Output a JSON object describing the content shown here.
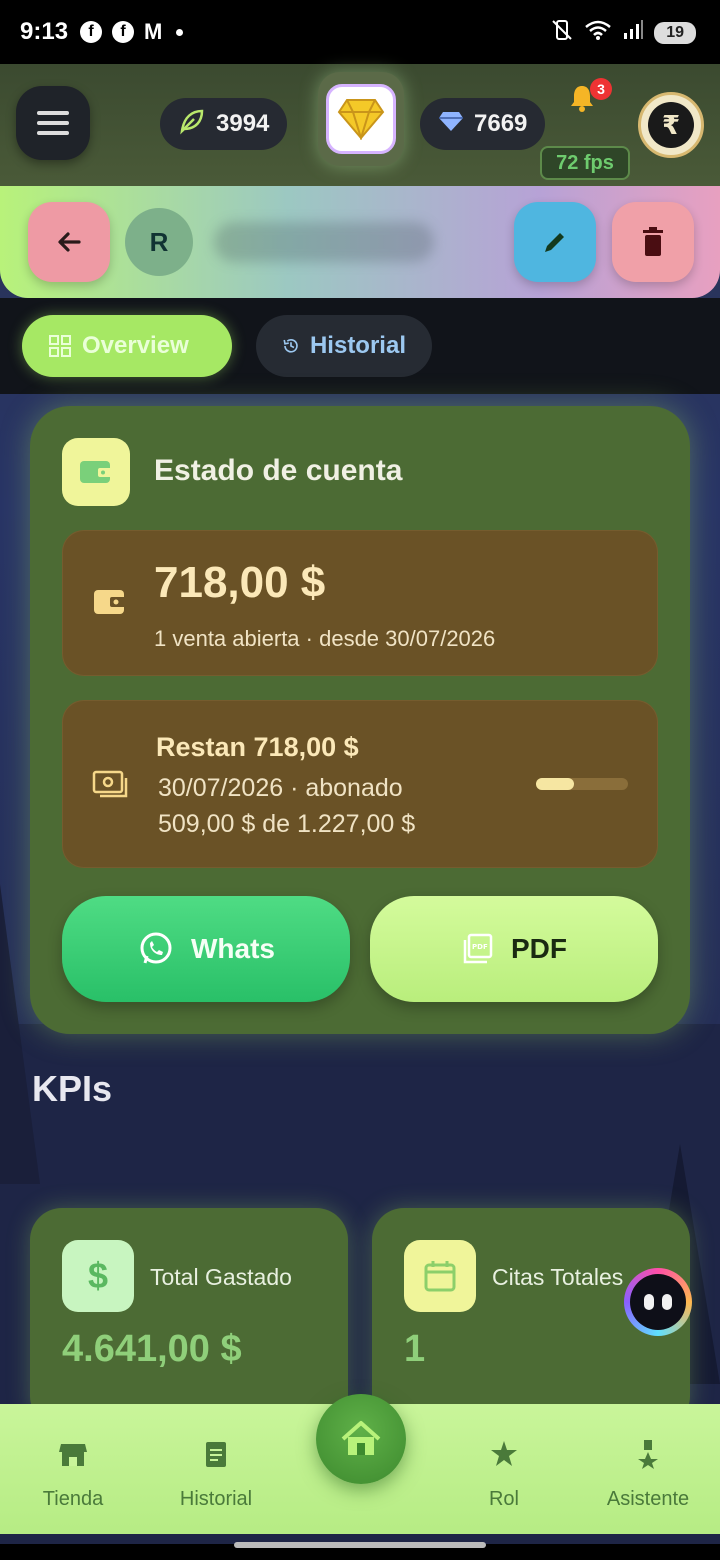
{
  "status_bar": {
    "time": "9:13",
    "left_icons": [
      "facebook-icon",
      "facebook-icon",
      "gmail-icon",
      "dot-icon"
    ],
    "right_icons": [
      "vibrate-mute-icon",
      "wifi-icon",
      "signal-icon"
    ],
    "battery": "19"
  },
  "header": {
    "leaves": "3994",
    "gems": "7669",
    "notifications_count": "3",
    "fps": "72 fps",
    "avatar_letter": "₹"
  },
  "profile": {
    "initial": "R"
  },
  "tabs": [
    {
      "label": "Overview",
      "active": true
    },
    {
      "label": "Historial",
      "active": false
    }
  ],
  "account": {
    "title": "Estado de cuenta",
    "balance": "718,00 $",
    "balance_sub": "1 venta abierta · desde 30/07/2026",
    "remaining": "Restan 718,00 $",
    "date_line": "30/07/2026 · abonado",
    "paid_line": "509,00 $ de 1.227,00 $",
    "progress": 0.415,
    "whats_label": "Whats",
    "pdf_label": "PDF"
  },
  "kpis": {
    "title": "KPIs",
    "items": [
      {
        "label": "Total Gastado",
        "value": "4.641,00 $",
        "icon": "$"
      },
      {
        "label": "Citas Totales",
        "value": "1",
        "icon": "calendar-icon"
      }
    ]
  },
  "bottom_nav": [
    {
      "label": "Tienda"
    },
    {
      "label": "Historial"
    },
    {
      "label": ""
    },
    {
      "label": "Rol"
    },
    {
      "label": "Asistente"
    }
  ],
  "colors": {
    "accent_green": "#a6e864",
    "card_green": "#4c6b34",
    "brown_box": "#6a5226",
    "whatsapp": "#29c068"
  }
}
